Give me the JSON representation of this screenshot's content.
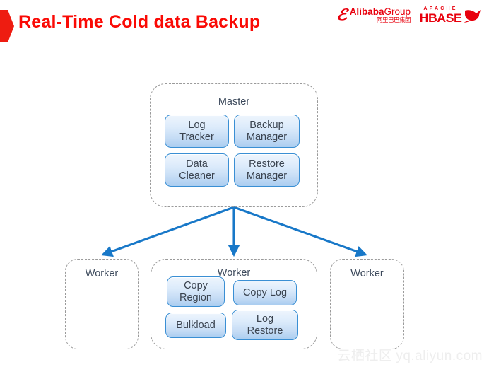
{
  "slide": {
    "title": "Real-Time Cold data Backup",
    "title_color": "#fa0a05",
    "bullet_color": "#ee1c11",
    "background": "#ffffff"
  },
  "logos": {
    "alibaba": {
      "mark": "ℰ",
      "name_bold": "Alibaba",
      "name_light": "Group",
      "chinese": "阿里巴巴集团",
      "color": "#e8000d"
    },
    "hbase": {
      "apache": "APACHE",
      "name": "HBASE",
      "orca_icon": "orca-whale-icon",
      "color": "#e8000d"
    }
  },
  "diagram": {
    "accent_color": "#1878c8",
    "node_border_color": "#3a8fd4",
    "group_border_color": "#9a9a9a",
    "master": {
      "title": "Master",
      "components": [
        {
          "id": "log-tracker",
          "label": "Log\nTracker"
        },
        {
          "id": "backup-manager",
          "label": "Backup\nManager"
        },
        {
          "id": "data-cleaner",
          "label": "Data\nCleaner"
        },
        {
          "id": "restore-manager",
          "label": "Restore\nManager"
        }
      ]
    },
    "workers": [
      {
        "id": "worker-left",
        "title": "Worker",
        "components": []
      },
      {
        "id": "worker-center",
        "title": "Worker",
        "components": [
          {
            "id": "copy-region",
            "label": "Copy\nRegion"
          },
          {
            "id": "copy-log",
            "label": "Copy Log"
          },
          {
            "id": "bulkload",
            "label": "Bulkload"
          },
          {
            "id": "log-restore",
            "label": "Log\nRestore"
          }
        ]
      },
      {
        "id": "worker-right",
        "title": "Worker",
        "components": []
      }
    ],
    "connections": [
      {
        "from": "master",
        "to": "worker-left",
        "style": "arrow"
      },
      {
        "from": "master",
        "to": "worker-center",
        "style": "arrow"
      },
      {
        "from": "master",
        "to": "worker-right",
        "style": "arrow"
      }
    ]
  },
  "watermark": {
    "chinese": "云栖社区",
    "url": "yq.aliyun.com"
  }
}
